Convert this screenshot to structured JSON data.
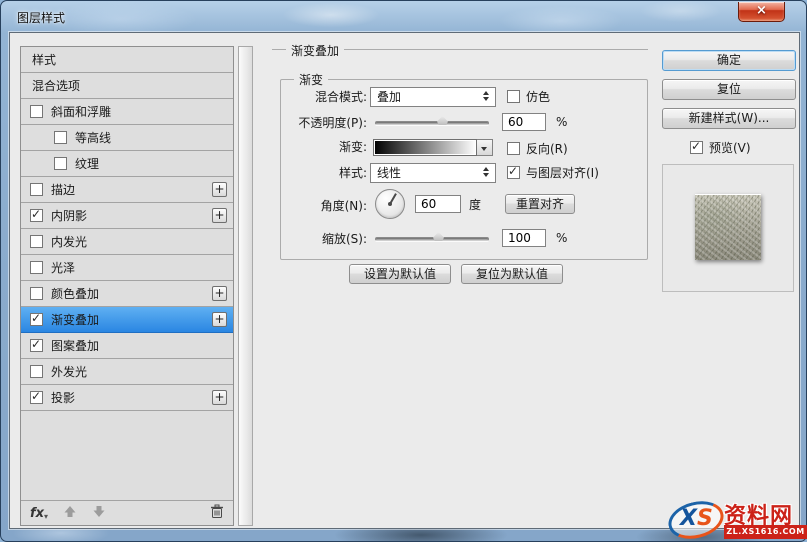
{
  "window": {
    "title": "图层样式",
    "close_glyph": "×"
  },
  "sidebar": {
    "items": [
      {
        "label": "样式",
        "cb": false,
        "checked": false,
        "indent": false,
        "plus": false,
        "selected": false
      },
      {
        "label": "混合选项",
        "cb": false,
        "checked": false,
        "indent": false,
        "plus": false,
        "selected": false
      },
      {
        "label": "斜面和浮雕",
        "cb": true,
        "checked": false,
        "indent": false,
        "plus": false,
        "selected": false
      },
      {
        "label": "等高线",
        "cb": true,
        "checked": false,
        "indent": true,
        "plus": false,
        "selected": false
      },
      {
        "label": "纹理",
        "cb": true,
        "checked": false,
        "indent": true,
        "plus": false,
        "selected": false
      },
      {
        "label": "描边",
        "cb": true,
        "checked": false,
        "indent": false,
        "plus": true,
        "selected": false
      },
      {
        "label": "内阴影",
        "cb": true,
        "checked": true,
        "indent": false,
        "plus": true,
        "selected": false
      },
      {
        "label": "内发光",
        "cb": true,
        "checked": false,
        "indent": false,
        "plus": false,
        "selected": false
      },
      {
        "label": "光泽",
        "cb": true,
        "checked": false,
        "indent": false,
        "plus": false,
        "selected": false
      },
      {
        "label": "颜色叠加",
        "cb": true,
        "checked": false,
        "indent": false,
        "plus": true,
        "selected": false
      },
      {
        "label": "渐变叠加",
        "cb": true,
        "checked": true,
        "indent": false,
        "plus": true,
        "selected": true
      },
      {
        "label": "图案叠加",
        "cb": true,
        "checked": true,
        "indent": false,
        "plus": false,
        "selected": false
      },
      {
        "label": "外发光",
        "cb": true,
        "checked": false,
        "indent": false,
        "plus": false,
        "selected": false
      },
      {
        "label": "投影",
        "cb": true,
        "checked": true,
        "indent": false,
        "plus": true,
        "selected": false
      }
    ],
    "footer": {
      "fx_label": "fx",
      "fx_dd": "▾"
    }
  },
  "main": {
    "section_title": "渐变叠加",
    "group_title": "渐变",
    "blend_mode": {
      "label": "混合模式:",
      "value": "叠加",
      "dither_label": "仿色",
      "dither_checked": false
    },
    "opacity": {
      "label": "不透明度(P):",
      "value": "60",
      "unit": "%"
    },
    "gradient": {
      "label": "渐变:",
      "reverse_label": "反向(R)",
      "reverse_checked": false
    },
    "style": {
      "label": "样式:",
      "value": "线性",
      "align_label": "与图层对齐(I)",
      "align_checked": true
    },
    "angle": {
      "label": "角度(N):",
      "value": "60",
      "unit": "度",
      "reset_label": "重置对齐",
      "degrees": 60
    },
    "scale": {
      "label": "缩放(S):",
      "value": "100",
      "unit": "%"
    },
    "buttons": {
      "set_default": "设置为默认值",
      "reset_default": "复位为默认值"
    }
  },
  "right_panel": {
    "ok_label": "确定",
    "reset_label": "复位",
    "new_style_label": "新建样式(W)...",
    "preview_label": "预览(V)",
    "preview_checked": true
  },
  "watermark": {
    "logo_x": "X",
    "logo_s": "S",
    "site": "资料网",
    "url": "ZL.XS1616.COM"
  },
  "colors": {
    "selection_blue": "#2a86e2",
    "close_red": "#c13317",
    "dialog_bg": "#ebebeb",
    "watermark_red": "#cc2218",
    "gradient_preview": [
      "#000000",
      "#ffffff"
    ]
  }
}
